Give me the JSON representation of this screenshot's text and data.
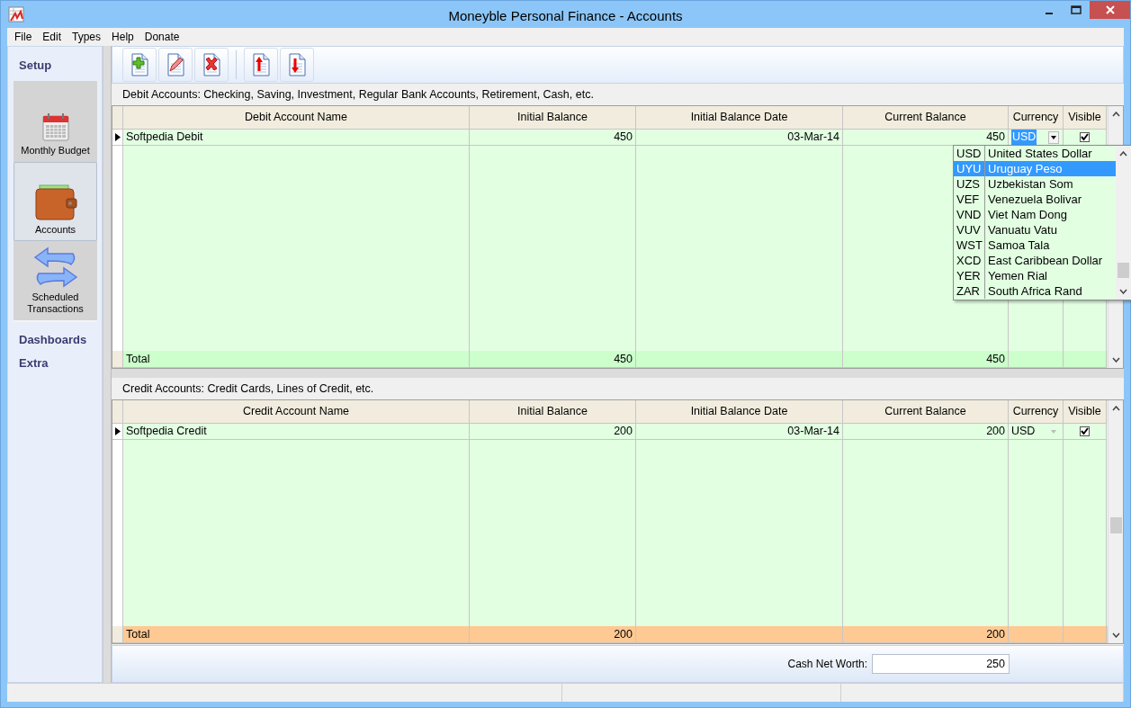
{
  "window": {
    "title": "Moneyble Personal Finance - Accounts"
  },
  "menu": [
    "File",
    "Edit",
    "Types",
    "Help",
    "Donate"
  ],
  "sidebar": {
    "sections": [
      {
        "label": "Setup",
        "items": [
          {
            "label": "Monthly Budget",
            "kind": "calendar",
            "selected": false
          },
          {
            "label": "Accounts",
            "kind": "wallet",
            "selected": true
          },
          {
            "label": "Scheduled Transactions",
            "kind": "arrows",
            "selected": false
          }
        ]
      },
      {
        "label": "Dashboards"
      },
      {
        "label": "Extra"
      }
    ]
  },
  "grids": [
    {
      "kind": "debit",
      "caption": "Debit Accounts: Checking, Saving, Investment, Regular Bank Accounts, Retirement, Cash, etc.",
      "columns": [
        "Debit Account Name",
        "Initial Balance",
        "Initial Balance Date",
        "Current Balance",
        "Currency",
        "Visible"
      ],
      "rows": [
        {
          "name": "Softpedia Debit",
          "initial_balance": "450",
          "initial_date": "03-Mar-14",
          "current_balance": "450",
          "currency": "USD",
          "visible": true,
          "editing": true
        }
      ],
      "total": {
        "label": "Total",
        "initial_balance": "450",
        "current_balance": "450"
      },
      "dropdown": [
        {
          "code": "USD",
          "name": "United States Dollar",
          "selected": false
        },
        {
          "code": "UYU",
          "name": "Uruguay Peso",
          "selected": true
        },
        {
          "code": "UZS",
          "name": "Uzbekistan Som",
          "selected": false
        },
        {
          "code": "VEF",
          "name": "Venezuela Bolivar",
          "selected": false
        },
        {
          "code": "VND",
          "name": "Viet Nam Dong",
          "selected": false
        },
        {
          "code": "VUV",
          "name": "Vanuatu Vatu",
          "selected": false
        },
        {
          "code": "WST",
          "name": "Samoa Tala",
          "selected": false
        },
        {
          "code": "XCD",
          "name": "East Caribbean Dollar",
          "selected": false
        },
        {
          "code": "YER",
          "name": "Yemen Rial",
          "selected": false
        },
        {
          "code": "ZAR",
          "name": "South Africa Rand",
          "selected": false
        }
      ]
    },
    {
      "kind": "credit",
      "caption": "Credit Accounts: Credit Cards, Lines of Credit, etc.",
      "columns": [
        "Credit Account Name",
        "Initial Balance",
        "Initial Balance Date",
        "Current Balance",
        "Currency",
        "Visible"
      ],
      "rows": [
        {
          "name": "Softpedia Credit",
          "initial_balance": "200",
          "initial_date": "03-Mar-14",
          "current_balance": "200",
          "currency": "USD",
          "visible": true,
          "editing": false
        }
      ],
      "total": {
        "label": "Total",
        "initial_balance": "200",
        "current_balance": "200"
      }
    }
  ],
  "net_worth": {
    "label": "Cash Net Worth:",
    "value": "250"
  }
}
